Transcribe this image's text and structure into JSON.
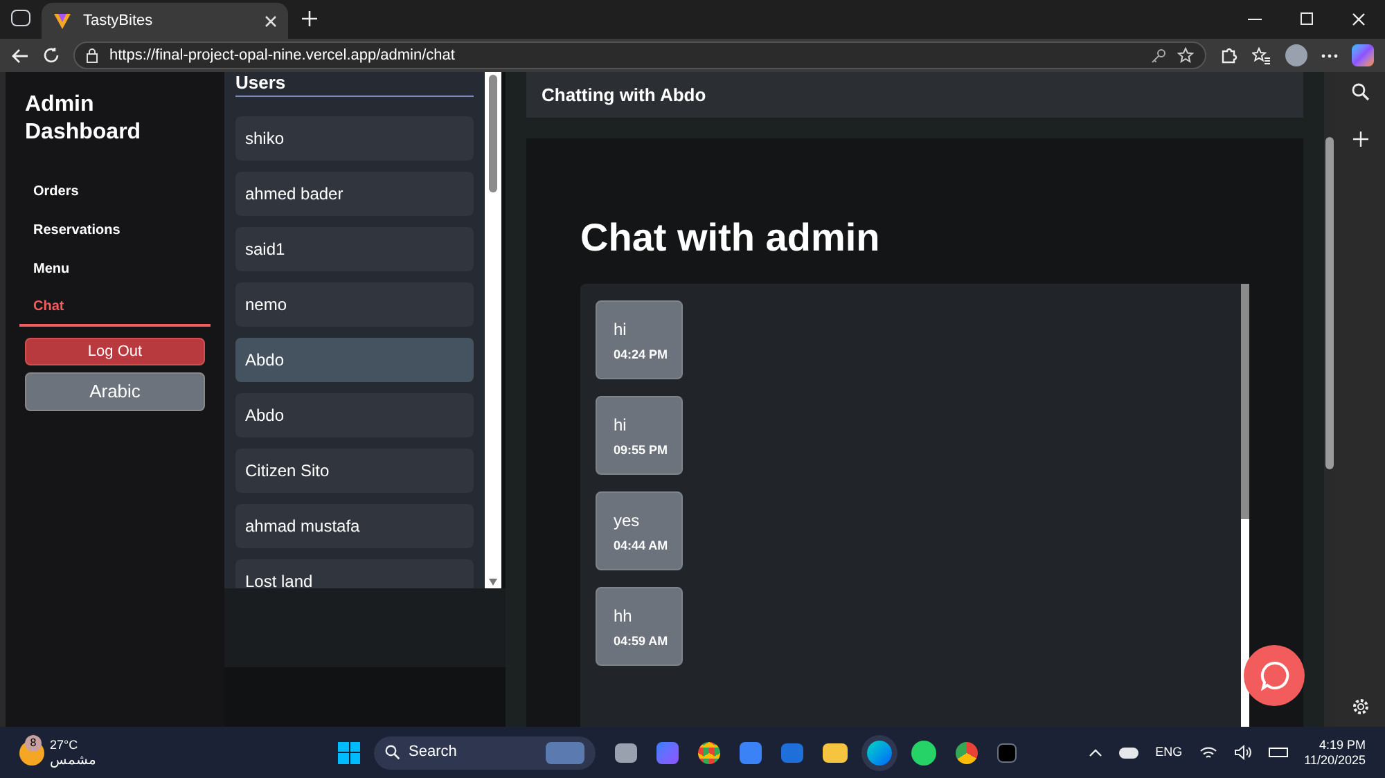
{
  "browser": {
    "tab_title": "TastyBites",
    "url": "https://final-project-opal-nine.vercel.app/admin/chat"
  },
  "sidebar": {
    "title": "Admin Dashboard",
    "nav": [
      {
        "label": "Orders",
        "selected": false
      },
      {
        "label": "Reservations",
        "selected": false
      },
      {
        "label": "Menu",
        "selected": false
      },
      {
        "label": "Chat",
        "selected": true
      }
    ],
    "logout": "Log Out",
    "language": "Arabic"
  },
  "users": {
    "heading": "Users",
    "items": [
      {
        "name": "shiko",
        "selected": false
      },
      {
        "name": "ahmed bader",
        "selected": false
      },
      {
        "name": "said1",
        "selected": false
      },
      {
        "name": "nemo",
        "selected": false
      },
      {
        "name": "Abdo",
        "selected": true
      },
      {
        "name": "Abdo",
        "selected": false
      },
      {
        "name": "Citizen Sito",
        "selected": false
      },
      {
        "name": "ahmad mustafa",
        "selected": false
      },
      {
        "name": "Lost land",
        "selected": false
      }
    ]
  },
  "chat": {
    "header": "Chatting with Abdo",
    "title": "Chat with admin",
    "messages": [
      {
        "text": "hi",
        "time": "04:24 PM"
      },
      {
        "text": "hi",
        "time": "09:55 PM"
      },
      {
        "text": "yes",
        "time": "04:44 AM"
      },
      {
        "text": "hh",
        "time": "04:59 AM"
      }
    ]
  },
  "taskbar": {
    "weather_badge": "8",
    "temperature": "27°C",
    "condition": "مشمس",
    "search": "Search",
    "language": "ENG",
    "time": "4:19 PM",
    "date": "11/20/2025"
  }
}
